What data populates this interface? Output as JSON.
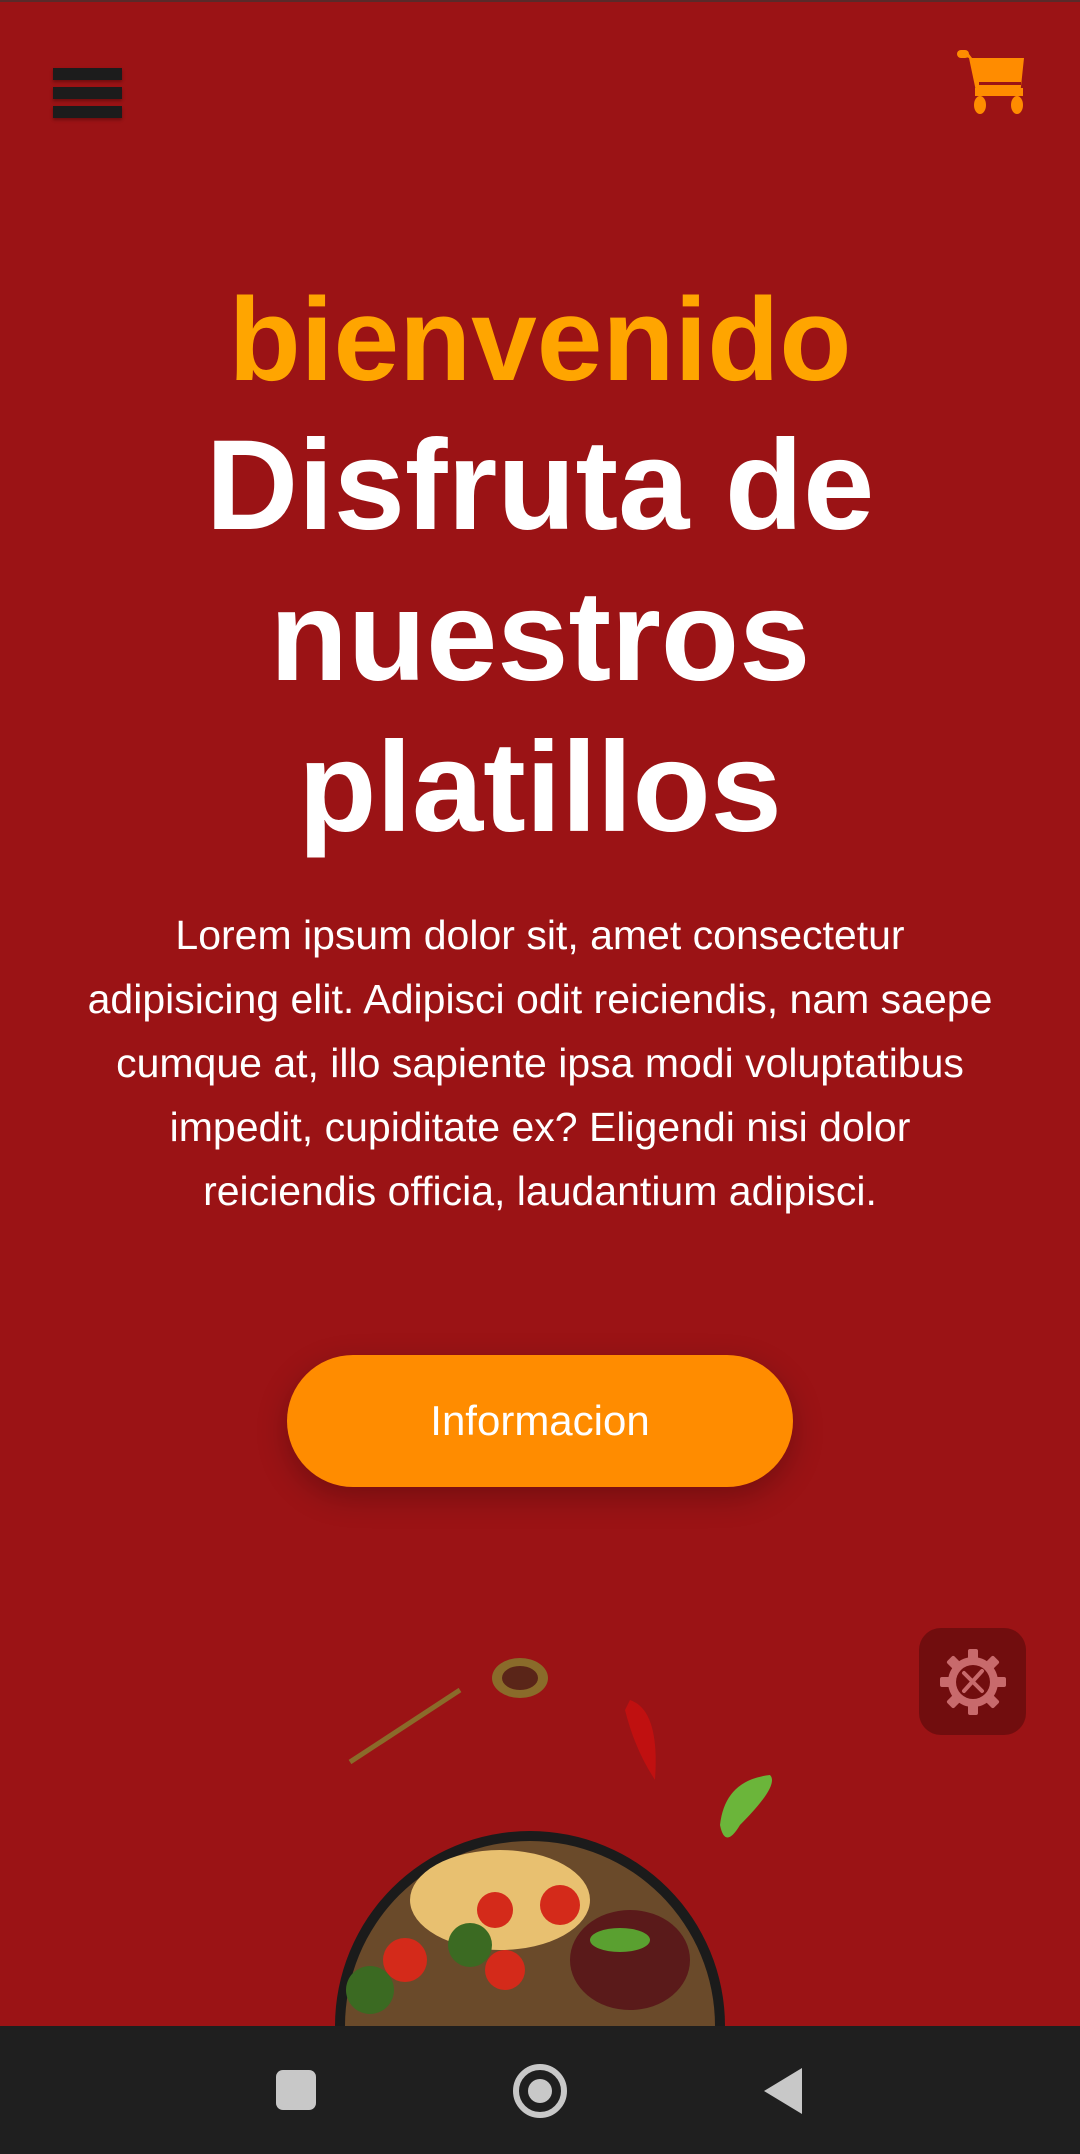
{
  "header": {
    "menu_icon": "hamburger-icon",
    "cart_icon": "cart-icon"
  },
  "hero": {
    "welcome": "bienvenido",
    "title": "Disfruta de nuestros platillos",
    "paragraph": "Lorem ipsum dolor sit, amet consectetur adipisicing elit. Adipisci odit reiciendis, nam saepe cumque at, illo sapiente ipsa modi voluptatibus impedit, cupiditate ex? Eligendi nisi dolor reiciendis officia, laudantium adipisci.",
    "button_label": "Informacion"
  },
  "colors": {
    "background": "#9b1315",
    "accent": "#ffa500",
    "button": "#ff8c00"
  }
}
